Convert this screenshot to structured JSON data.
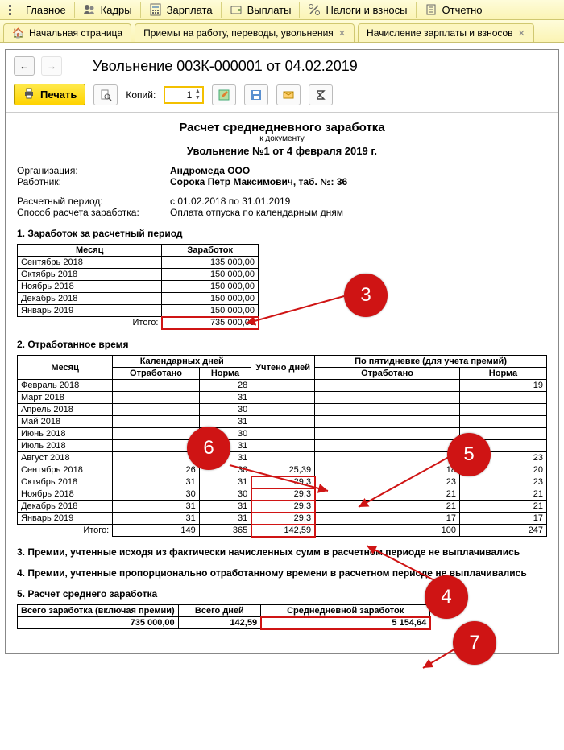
{
  "menu": {
    "items": [
      "Главное",
      "Кадры",
      "Зарплата",
      "Выплаты",
      "Налоги и взносы",
      "Отчетно"
    ]
  },
  "tabs": [
    {
      "label": "Начальная страница",
      "closable": false,
      "home": true
    },
    {
      "label": "Приемы на работу, переводы, увольнения",
      "closable": true
    },
    {
      "label": "Начисление зарплаты и взносов",
      "closable": true
    }
  ],
  "page_title": "Увольнение 003К-000001 от 04.02.2019",
  "toolbar": {
    "print": "Печать",
    "copies_label": "Копий:",
    "copies_value": "1"
  },
  "doc": {
    "title": "Расчет среднедневного заработка",
    "subtitle": "к документу",
    "docline": "Увольнение №1 от 4 февраля 2019 г.",
    "org_label": "Организация:",
    "org_value": "Андромеда ООО",
    "emp_label": "Работник:",
    "emp_value": "Сорока Петр Максимович, таб. №: 36",
    "period_label": "Расчетный период:",
    "period_value": "с 01.02.2018 по 31.01.2019",
    "method_label": "Способ расчета заработка:",
    "method_value": "Оплата отпуска по календарным дням",
    "sect1": "1. Заработок за расчетный период",
    "t1_headers": [
      "Месяц",
      "Заработок"
    ],
    "t1_rows": [
      [
        "Сентябрь 2018",
        "135 000,00"
      ],
      [
        "Октябрь 2018",
        "150 000,00"
      ],
      [
        "Ноябрь 2018",
        "150 000,00"
      ],
      [
        "Декабрь 2018",
        "150 000,00"
      ],
      [
        "Январь 2019",
        "150 000,00"
      ]
    ],
    "t1_total_label": "Итого:",
    "t1_total_value": "735 000,00",
    "sect2": "2. Отработанное время",
    "t2_head_month": "Месяц",
    "t2_head_cal": "Календарных дней",
    "t2_head_acc": "Учтено дней",
    "t2_head_five": "По пятидневке (для учета премий)",
    "t2_head_worked": "Отработано",
    "t2_head_norm": "Норма",
    "t2_rows": [
      [
        "Февраль 2018",
        "",
        "28",
        "",
        "",
        "19"
      ],
      [
        "Март 2018",
        "",
        "31",
        "",
        "",
        ""
      ],
      [
        "Апрель 2018",
        "",
        "30",
        "",
        "",
        ""
      ],
      [
        "Май 2018",
        "",
        "31",
        "",
        "",
        ""
      ],
      [
        "Июнь 2018",
        "",
        "30",
        "",
        "",
        ""
      ],
      [
        "Июль 2018",
        "",
        "31",
        "",
        "",
        ""
      ],
      [
        "Август 2018",
        "",
        "31",
        "",
        "",
        "23"
      ],
      [
        "Сентябрь 2018",
        "26",
        "30",
        "25,39",
        "18",
        "20"
      ],
      [
        "Октябрь 2018",
        "31",
        "31",
        "29,3",
        "23",
        "23"
      ],
      [
        "Ноябрь 2018",
        "30",
        "30",
        "29,3",
        "21",
        "21"
      ],
      [
        "Декабрь 2018",
        "31",
        "31",
        "29,3",
        "21",
        "21"
      ],
      [
        "Январь 2019",
        "31",
        "31",
        "29,3",
        "17",
        "17"
      ]
    ],
    "t2_total": [
      "Итого:",
      "149",
      "365",
      "142,59",
      "100",
      "247"
    ],
    "sect3": "3. Премии, учтенные исходя из фактически начисленных сумм в расчетном периоде не выплачивались",
    "sect4": "4. Премии, учтенные пропорционально отработанному времени в расчетном периоде не выплачивались",
    "sect5": "5. Расчет среднего  заработка",
    "t3_headers": [
      "Всего заработка (включая премии)",
      "Всего дней",
      "Среднедневной заработок"
    ],
    "t3_values": [
      "735 000,00",
      "142,59",
      "5 154,64"
    ]
  },
  "annotations": {
    "a3": "3",
    "a4": "4",
    "a5": "5",
    "a6": "6",
    "a7": "7"
  },
  "chart_data": null
}
